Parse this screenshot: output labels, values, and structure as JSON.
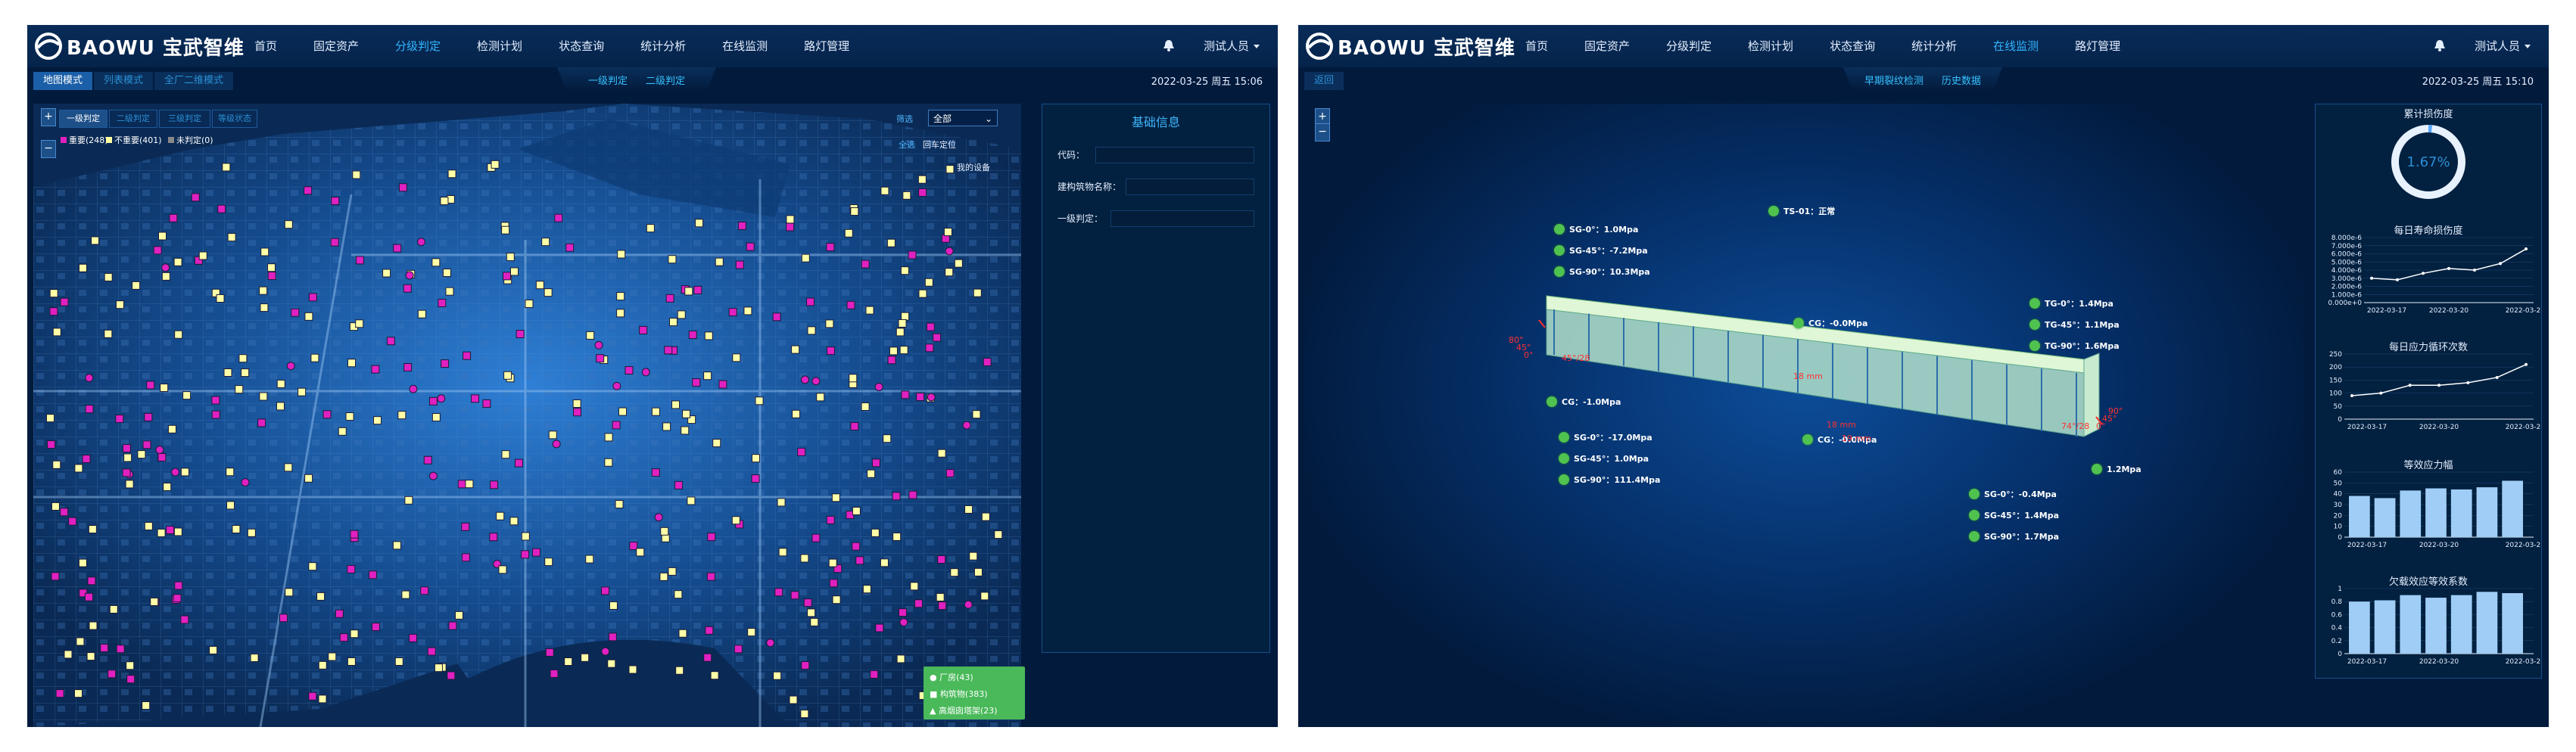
{
  "brand": {
    "name": "BAOWU 宝武智维"
  },
  "left_screen": {
    "nav": [
      "首页",
      "固定资产",
      "分级判定",
      "检测计划",
      "状态查询",
      "统计分析",
      "在线监测",
      "路灯管理"
    ],
    "active_nav": 2,
    "user": "测试人员",
    "tabs": [
      "地图模式",
      "列表模式",
      "全厂二维模式"
    ],
    "active_tab": 0,
    "center_tabs": [
      "一级判定",
      "二级判定"
    ],
    "datetime": "2022-03-25 周五 15:06",
    "level_buttons": [
      "一级判定",
      "二级判定",
      "三级判定",
      "等级状态"
    ],
    "active_level": 0,
    "legend_counts": [
      {
        "label": "重要(248)",
        "color": "#e020c0"
      },
      {
        "label": "不重要(401)",
        "color": "#ffffa0"
      },
      {
        "label": "未判定(0)",
        "color": "#888888"
      }
    ],
    "filters": {
      "label_1": "筛选",
      "select_value": "全部",
      "label_2": "全选",
      "label_3": "回车定位",
      "label_4": "我的设备"
    },
    "zoom": {
      "plus": "+",
      "minus": "−"
    },
    "info_panel": {
      "title": "基础信息",
      "fields": [
        "代码：",
        "建构筑物名称：",
        "一级判定："
      ]
    },
    "bottom_legend": [
      "厂房(43)",
      "构筑物(383)",
      "高烟囱塔架(23)"
    ]
  },
  "right_screen": {
    "nav": [
      "首页",
      "固定资产",
      "分级判定",
      "检测计划",
      "状态查询",
      "统计分析",
      "在线监测",
      "路灯管理"
    ],
    "active_nav": 6,
    "user": "测试人员",
    "back_button": "返回",
    "center_tabs": [
      "早期裂纹检测",
      "历史数据"
    ],
    "datetime": "2022-03-25 周五 15:10",
    "zoom": {
      "plus": "+",
      "minus": "−"
    },
    "sensors_left": [
      {
        "label": "SG-0°：1.0Mpa"
      },
      {
        "label": "SG-45°：-7.2Mpa"
      },
      {
        "label": "SG-90°：10.3Mpa"
      }
    ],
    "sensors_left_lower": [
      {
        "label": "SG-0°：-17.0Mpa"
      },
      {
        "label": "SG-45°：1.0Mpa"
      },
      {
        "label": "SG-90°：111.4Mpa"
      }
    ],
    "sensors_top": [
      {
        "label": "TS-01：正常"
      }
    ],
    "sensors_mid": [
      {
        "label": "CG：-0.0Mpa"
      }
    ],
    "sensors_mid_lower": [
      {
        "label": "CG：-0.0Mpa"
      }
    ],
    "sensors_right": [
      {
        "label": "TG-0°：1.4Mpa"
      },
      {
        "label": "TG-45°：1.1Mpa"
      },
      {
        "label": "TG-90°：1.6Mpa"
      }
    ],
    "sensors_right_lower": [
      {
        "label": "SG-0°：-0.4Mpa"
      },
      {
        "label": "SG-45°：1.4Mpa"
      },
      {
        "label": "SG-90°：1.7Mpa"
      }
    ],
    "sensor_edge": [
      {
        "label": "CG：-1.0Mpa"
      },
      {
        "label": "1.2Mpa"
      }
    ],
    "beam_marks": [
      "45°/28",
      "18 mm",
      "18 mm",
      "19 mm",
      "74°/28"
    ],
    "angle_marks_left": [
      "80°",
      "45°",
      "0°"
    ],
    "angle_marks_right": [
      "90°",
      "45°",
      "0°"
    ],
    "charts": {
      "damage": {
        "title": "累计损伤度",
        "value_text": "1.67%",
        "value": 1.67
      },
      "life": {
        "title": "每日寿命损伤度",
        "type": "line",
        "y_ticks": [
          "8.000e-6",
          "7.000e-6",
          "6.000e-6",
          "5.000e-6",
          "4.000e-6",
          "3.000e-6",
          "2.000e-6",
          "1.000e-6",
          "0.000e+0"
        ],
        "x_ticks": [
          "2022-03-17",
          "2022-03-20",
          "2022-03-2"
        ],
        "values": [
          3.0,
          2.8,
          3.6,
          4.2,
          4.0,
          4.8,
          6.6
        ],
        "ylim": [
          0,
          8
        ]
      },
      "cycles": {
        "title": "每日应力循环次数",
        "type": "line",
        "y_ticks": [
          "250",
          "200",
          "150",
          "100",
          "50",
          "0"
        ],
        "x_ticks": [
          "2022-03-17",
          "2022-03-20",
          "2022-03-2"
        ],
        "values": [
          90,
          100,
          130,
          130,
          140,
          160,
          210
        ],
        "ylim": [
          0,
          250
        ]
      },
      "stress": {
        "title": "等效应力幅",
        "type": "bar",
        "y_ticks": [
          "60",
          "50",
          "40",
          "30",
          "20",
          "10",
          "0"
        ],
        "x_ticks": [
          "2022-03-17",
          "2022-03-20",
          "2022-03-2"
        ],
        "values": [
          38,
          36,
          43,
          45,
          44,
          46,
          52
        ],
        "ylim": [
          0,
          60
        ]
      },
      "coef": {
        "title": "欠载效应等效系数",
        "type": "bar",
        "y_ticks": [
          "1",
          "0.8",
          "0.6",
          "0.4",
          "0.2",
          "0"
        ],
        "x_ticks": [
          "2022-03-17",
          "2022-03-20",
          "2022-03-2"
        ],
        "values": [
          0.8,
          0.82,
          0.9,
          0.86,
          0.9,
          0.95,
          0.93
        ],
        "ylim": [
          0,
          1
        ]
      }
    }
  }
}
